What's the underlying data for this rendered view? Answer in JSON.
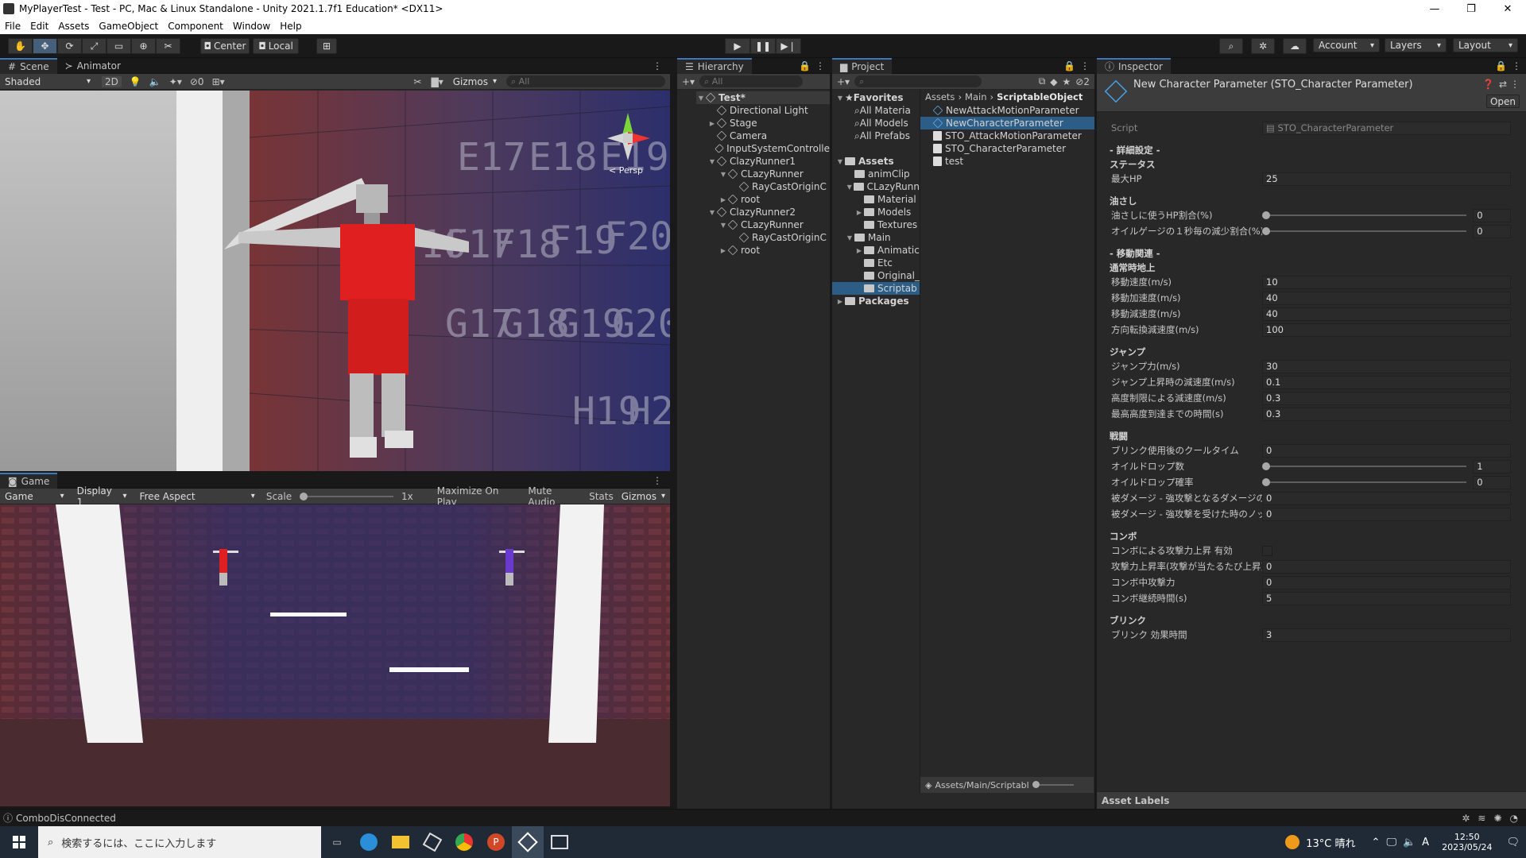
{
  "window": {
    "title": "MyPlayerTest - Test - PC, Mac & Linux Standalone - Unity 2021.1.7f1 Education* <DX11>"
  },
  "menu": [
    "File",
    "Edit",
    "Assets",
    "GameObject",
    "Component",
    "Window",
    "Help"
  ],
  "toolbar": {
    "center": "Center",
    "local": "Local",
    "account": "Account",
    "layers": "Layers",
    "layout": "Layout"
  },
  "scene": {
    "tabs": {
      "scene": "Scene",
      "animator": "Animator"
    },
    "shading": "Shaded",
    "mode2d": "2D",
    "hidden_count": "0",
    "gizmos": "Gizmos",
    "search_placeholder": "All",
    "persp": "< Persp",
    "grid_labels": [
      "E17",
      "E18",
      "E19",
      "F20",
      "F16",
      "F17",
      "F18",
      "F19",
      "F20",
      "G17",
      "G18",
      "G19",
      "G20",
      "H19",
      "H2"
    ]
  },
  "game": {
    "tab": "Game",
    "mode": "Game",
    "display": "Display 1",
    "aspect": "Free Aspect",
    "scale_label": "Scale",
    "scale_value": "1x",
    "maximize": "Maximize On Play",
    "mute": "Mute Audio",
    "stats": "Stats",
    "gizmos": "Gizmos"
  },
  "hierarchy": {
    "tab": "Hierarchy",
    "search_placeholder": "All",
    "items": [
      {
        "label": "Test*",
        "depth": 0,
        "arrow": "▼",
        "icon": "scene"
      },
      {
        "label": "Directional Light",
        "depth": 1,
        "arrow": "",
        "icon": "go"
      },
      {
        "label": "Stage",
        "depth": 1,
        "arrow": "▶",
        "icon": "go"
      },
      {
        "label": "Camera",
        "depth": 1,
        "arrow": "",
        "icon": "go"
      },
      {
        "label": "InputSystemControlle",
        "depth": 1,
        "arrow": "",
        "icon": "go"
      },
      {
        "label": "ClazyRunner1",
        "depth": 1,
        "arrow": "▼",
        "icon": "go"
      },
      {
        "label": "CLazyRunner",
        "depth": 2,
        "arrow": "▼",
        "icon": "go"
      },
      {
        "label": "RayCastOriginC",
        "depth": 3,
        "arrow": "",
        "icon": "go"
      },
      {
        "label": "root",
        "depth": 2,
        "arrow": "▶",
        "icon": "go"
      },
      {
        "label": "ClazyRunner2",
        "depth": 1,
        "arrow": "▼",
        "icon": "go"
      },
      {
        "label": "CLazyRunner",
        "depth": 2,
        "arrow": "▼",
        "icon": "go"
      },
      {
        "label": "RayCastOriginC",
        "depth": 3,
        "arrow": "",
        "icon": "go"
      },
      {
        "label": "root",
        "depth": 2,
        "arrow": "▶",
        "icon": "go"
      }
    ]
  },
  "project": {
    "tab": "Project",
    "hidden_count": "2",
    "tree": [
      {
        "label": "Favorites",
        "depth": 0,
        "arrow": "▼",
        "icon": "star",
        "bold": true
      },
      {
        "label": "All Materia",
        "depth": 1,
        "arrow": "",
        "icon": "search"
      },
      {
        "label": "All Models",
        "depth": 1,
        "arrow": "",
        "icon": "search"
      },
      {
        "label": "All Prefabs",
        "depth": 1,
        "arrow": "",
        "icon": "search"
      },
      {
        "label": "",
        "depth": 0,
        "arrow": "",
        "icon": "none"
      },
      {
        "label": "Assets",
        "depth": 0,
        "arrow": "▼",
        "icon": "folder",
        "bold": true
      },
      {
        "label": "animClip",
        "depth": 1,
        "arrow": "",
        "icon": "folder"
      },
      {
        "label": "CLazyRunn",
        "depth": 1,
        "arrow": "▼",
        "icon": "folder"
      },
      {
        "label": "Material",
        "depth": 2,
        "arrow": "",
        "icon": "folder"
      },
      {
        "label": "Models",
        "depth": 2,
        "arrow": "▶",
        "icon": "folder"
      },
      {
        "label": "Textures",
        "depth": 2,
        "arrow": "",
        "icon": "folder"
      },
      {
        "label": "Main",
        "depth": 1,
        "arrow": "▼",
        "icon": "folder"
      },
      {
        "label": "Animatic",
        "depth": 2,
        "arrow": "▶",
        "icon": "folder"
      },
      {
        "label": "Etc",
        "depth": 2,
        "arrow": "",
        "icon": "folder"
      },
      {
        "label": "Original_",
        "depth": 2,
        "arrow": "",
        "icon": "folder"
      },
      {
        "label": "Scriptab",
        "depth": 2,
        "arrow": "",
        "icon": "folder",
        "selected": true
      },
      {
        "label": "Packages",
        "depth": 0,
        "arrow": "▶",
        "icon": "folder",
        "bold": true
      }
    ],
    "breadcrumb": [
      "Assets",
      "Main",
      "ScriptableObject"
    ],
    "files": [
      {
        "label": "NewAttackMotionParameter",
        "icon": "so"
      },
      {
        "label": "NewCharacterParameter",
        "icon": "so",
        "selected": true
      },
      {
        "label": "STO_AttackMotionParameter",
        "icon": "script"
      },
      {
        "label": "STO_CharacterParameter",
        "icon": "script"
      },
      {
        "label": "test",
        "icon": "script"
      }
    ],
    "footer_path": "Assets/Main/Scriptabl"
  },
  "inspector": {
    "tab": "Inspector",
    "title": "New Character Parameter (STO_Character Parameter)",
    "open": "Open",
    "script_label": "Script",
    "script_value": "STO_CharacterParameter",
    "asset_labels": "Asset Labels",
    "sections": [
      {
        "header": [
          "- 詳細設定 -",
          "ステータス"
        ],
        "rows": [
          {
            "label": "最大HP",
            "value": "25"
          }
        ]
      },
      {
        "header": [
          "油さし"
        ],
        "rows": [
          {
            "label": "油さしに使うHP割合(%)",
            "value": "0",
            "slider": 0.0
          },
          {
            "label": "オイルゲージの１秒毎の減少割合(%)",
            "value": "0",
            "slider": 0.0
          }
        ]
      },
      {
        "header": [
          "- 移動関連 -",
          "通常時地上"
        ],
        "rows": [
          {
            "label": "移動速度(m/s)",
            "value": "10"
          },
          {
            "label": "移動加速度(m/s)",
            "value": "40"
          },
          {
            "label": "移動減速度(m/s)",
            "value": "40"
          },
          {
            "label": "方向転換減速度(m/s)",
            "value": "100"
          }
        ]
      },
      {
        "header": [
          "ジャンプ"
        ],
        "rows": [
          {
            "label": "ジャンプ力(m/s)",
            "value": "30"
          },
          {
            "label": "ジャンプ上昇時の減速度(m/s)",
            "value": "0.1"
          },
          {
            "label": "高度制限による減速度(m/s)",
            "value": "0.3"
          },
          {
            "label": "最高高度到達までの時間(s)",
            "value": "0.3"
          }
        ]
      },
      {
        "header": [
          "戦闘"
        ],
        "rows": [
          {
            "label": "ブリンク使用後のクールタイム",
            "value": "0"
          },
          {
            "label": "オイルドロップ数",
            "value": "1",
            "slider": 0.0
          },
          {
            "label": "オイルドロップ確率",
            "value": "0",
            "slider": 0.0
          },
          {
            "label": "被ダメージ - 強攻撃となるダメージの値の最",
            "value": "0"
          },
          {
            "label": "被ダメージ - 強攻撃を受けた時のノックバッ",
            "value": "0"
          }
        ]
      },
      {
        "header": [
          "コンボ"
        ],
        "rows": [
          {
            "label": "コンボによる攻撃力上昇 有効",
            "value": "",
            "checkbox": true
          },
          {
            "label": "攻撃力上昇率(攻撃が当たるたび上昇)",
            "value": "0"
          },
          {
            "label": "コンボ中攻撃力",
            "value": "0"
          },
          {
            "label": "コンボ継続時間(s)",
            "value": "5"
          }
        ]
      },
      {
        "header": [
          "ブリンク"
        ],
        "rows": [
          {
            "label": "ブリンク 効果時間",
            "value": "3"
          }
        ]
      }
    ]
  },
  "status": {
    "message": "ComboDisConnected"
  },
  "taskbar": {
    "search_placeholder": "検索するには、ここに入力します",
    "weather": "13°C 晴れ",
    "time": "12:50",
    "date": "2023/05/24",
    "ime": "A"
  },
  "colors": {
    "accent": "#3a79bb",
    "selection": "#2c5d87",
    "character_red": "#e02020",
    "character_blue": "#6a3ad0"
  }
}
